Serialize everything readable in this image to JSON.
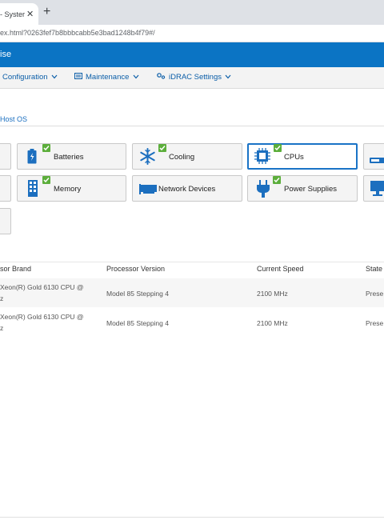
{
  "browser": {
    "tab_title": "- Syster",
    "tab_close": "✕",
    "new_tab": "+",
    "url": "ex.html?0263fef7b8bbbcabb5e3bad1248b4f79#/"
  },
  "app": {
    "brand_text": "ise"
  },
  "menu": {
    "configuration": "Configuration",
    "maintenance": "Maintenance",
    "idrac_settings": "iDRAC Settings",
    "chevron": "⌵"
  },
  "breadcrumb": {
    "host_os": "Host OS"
  },
  "tiles": {
    "batteries": "Batteries",
    "cooling": "Cooling",
    "cpus": "CPUs",
    "memory": "Memory",
    "network_devices": "Network Devices",
    "power_supplies": "Power Supplies"
  },
  "table": {
    "headers": [
      "sor Brand",
      "Processor Version",
      "Current Speed",
      "State"
    ],
    "rows": [
      {
        "brand_line1": "Xeon(R) Gold 6130 CPU @",
        "brand_line2": "z",
        "version": "Model 85 Stepping 4",
        "speed": "2100 MHz",
        "state": "Prese"
      },
      {
        "brand_line1": "Xeon(R) Gold 6130 CPU @",
        "brand_line2": "z",
        "version": "Model 85 Stepping 4",
        "speed": "2100 MHz",
        "state": "Prese"
      }
    ]
  },
  "colors": {
    "brand_blue": "#0b74c4",
    "link_blue": "#1b6fc0",
    "selected_border": "#1a73c6",
    "status_green": "#5cae3b"
  }
}
